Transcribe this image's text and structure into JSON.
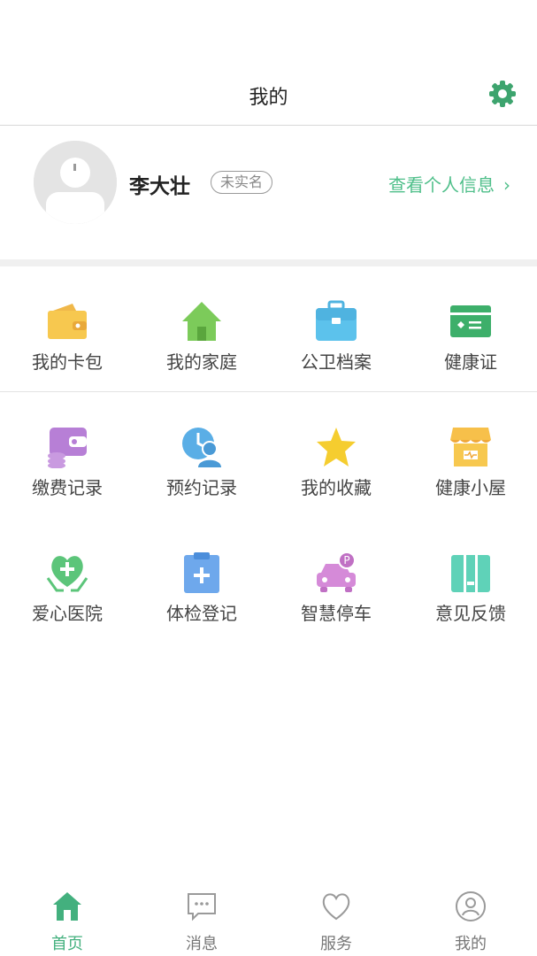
{
  "header": {
    "title": "我的"
  },
  "profile": {
    "name": "李大壮",
    "verify_badge": "未实名",
    "info_link": "查看个人信息"
  },
  "grid": [
    {
      "label": "我的卡包",
      "icon": "wallet-icon"
    },
    {
      "label": "我的家庭",
      "icon": "home-icon"
    },
    {
      "label": "公卫档案",
      "icon": "briefcase-icon"
    },
    {
      "label": "健康证",
      "icon": "card-icon"
    },
    {
      "label": "缴费记录",
      "icon": "payment-icon"
    },
    {
      "label": "预约记录",
      "icon": "appointment-icon"
    },
    {
      "label": "我的收藏",
      "icon": "star-icon"
    },
    {
      "label": "健康小屋",
      "icon": "store-icon"
    },
    {
      "label": "爱心医院",
      "icon": "heart-hospital-icon"
    },
    {
      "label": "体检登记",
      "icon": "clipboard-icon"
    },
    {
      "label": "智慧停车",
      "icon": "parking-car-icon"
    },
    {
      "label": "意见反馈",
      "icon": "feedback-icon"
    }
  ],
  "tabbar": [
    {
      "label": "首页",
      "icon": "home-icon",
      "active": true
    },
    {
      "label": "消息",
      "icon": "message-icon",
      "active": false
    },
    {
      "label": "服务",
      "icon": "heart-icon",
      "active": false
    },
    {
      "label": "我的",
      "icon": "user-icon",
      "active": false
    }
  ],
  "colors": {
    "accent": "#43b07e",
    "link": "#4fbf8a"
  }
}
